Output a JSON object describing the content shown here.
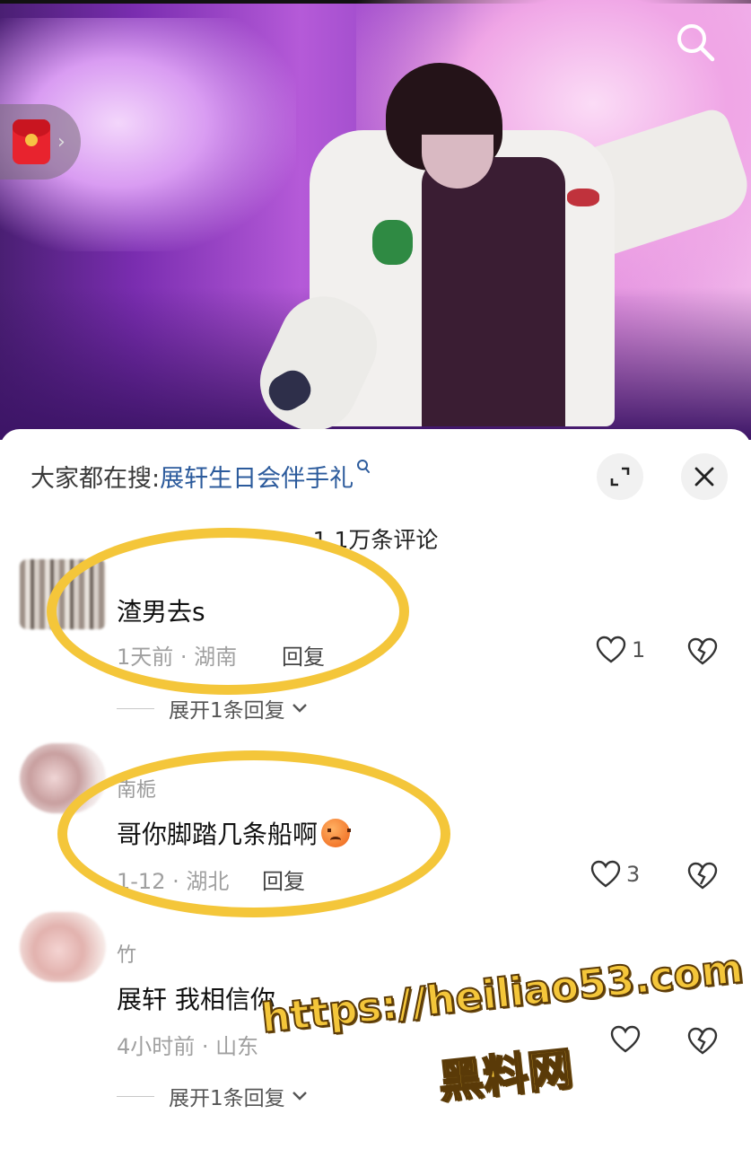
{
  "video": {
    "search_icon": "search-icon",
    "red_packet_icon": "red-envelope-icon",
    "chevron": "›"
  },
  "sheet": {
    "search_label": "大家都在搜:",
    "search_term": "展轩生日会伴手礼",
    "comment_count": "1.1万条评论"
  },
  "comments": [
    {
      "username": "",
      "text": "渣男去s",
      "time": "1天前",
      "location": "湖南",
      "meta": "1天前 · 湖南",
      "reply_label": "回复",
      "likes": "1",
      "expand_label": "展开1条回复"
    },
    {
      "username": "南栀",
      "text": "哥你脚踏几条船啊",
      "emoji": "angry-face",
      "time": "1-12",
      "location": "湖北",
      "meta": "1-12 · 湖北",
      "reply_label": "回复",
      "likes": "3"
    },
    {
      "username": "竹",
      "text": "展轩 我相信你",
      "time": "4小时前",
      "location": "山东",
      "meta": "4小时前 · 山东",
      "reply_label": "回复",
      "likes": "",
      "expand_label": "展开1条回复"
    }
  ],
  "watermark": {
    "url": "https://heiliao53.com",
    "name": "黑料网"
  },
  "colors": {
    "highlight": "#f4c63a",
    "link": "#2c5b9c"
  }
}
